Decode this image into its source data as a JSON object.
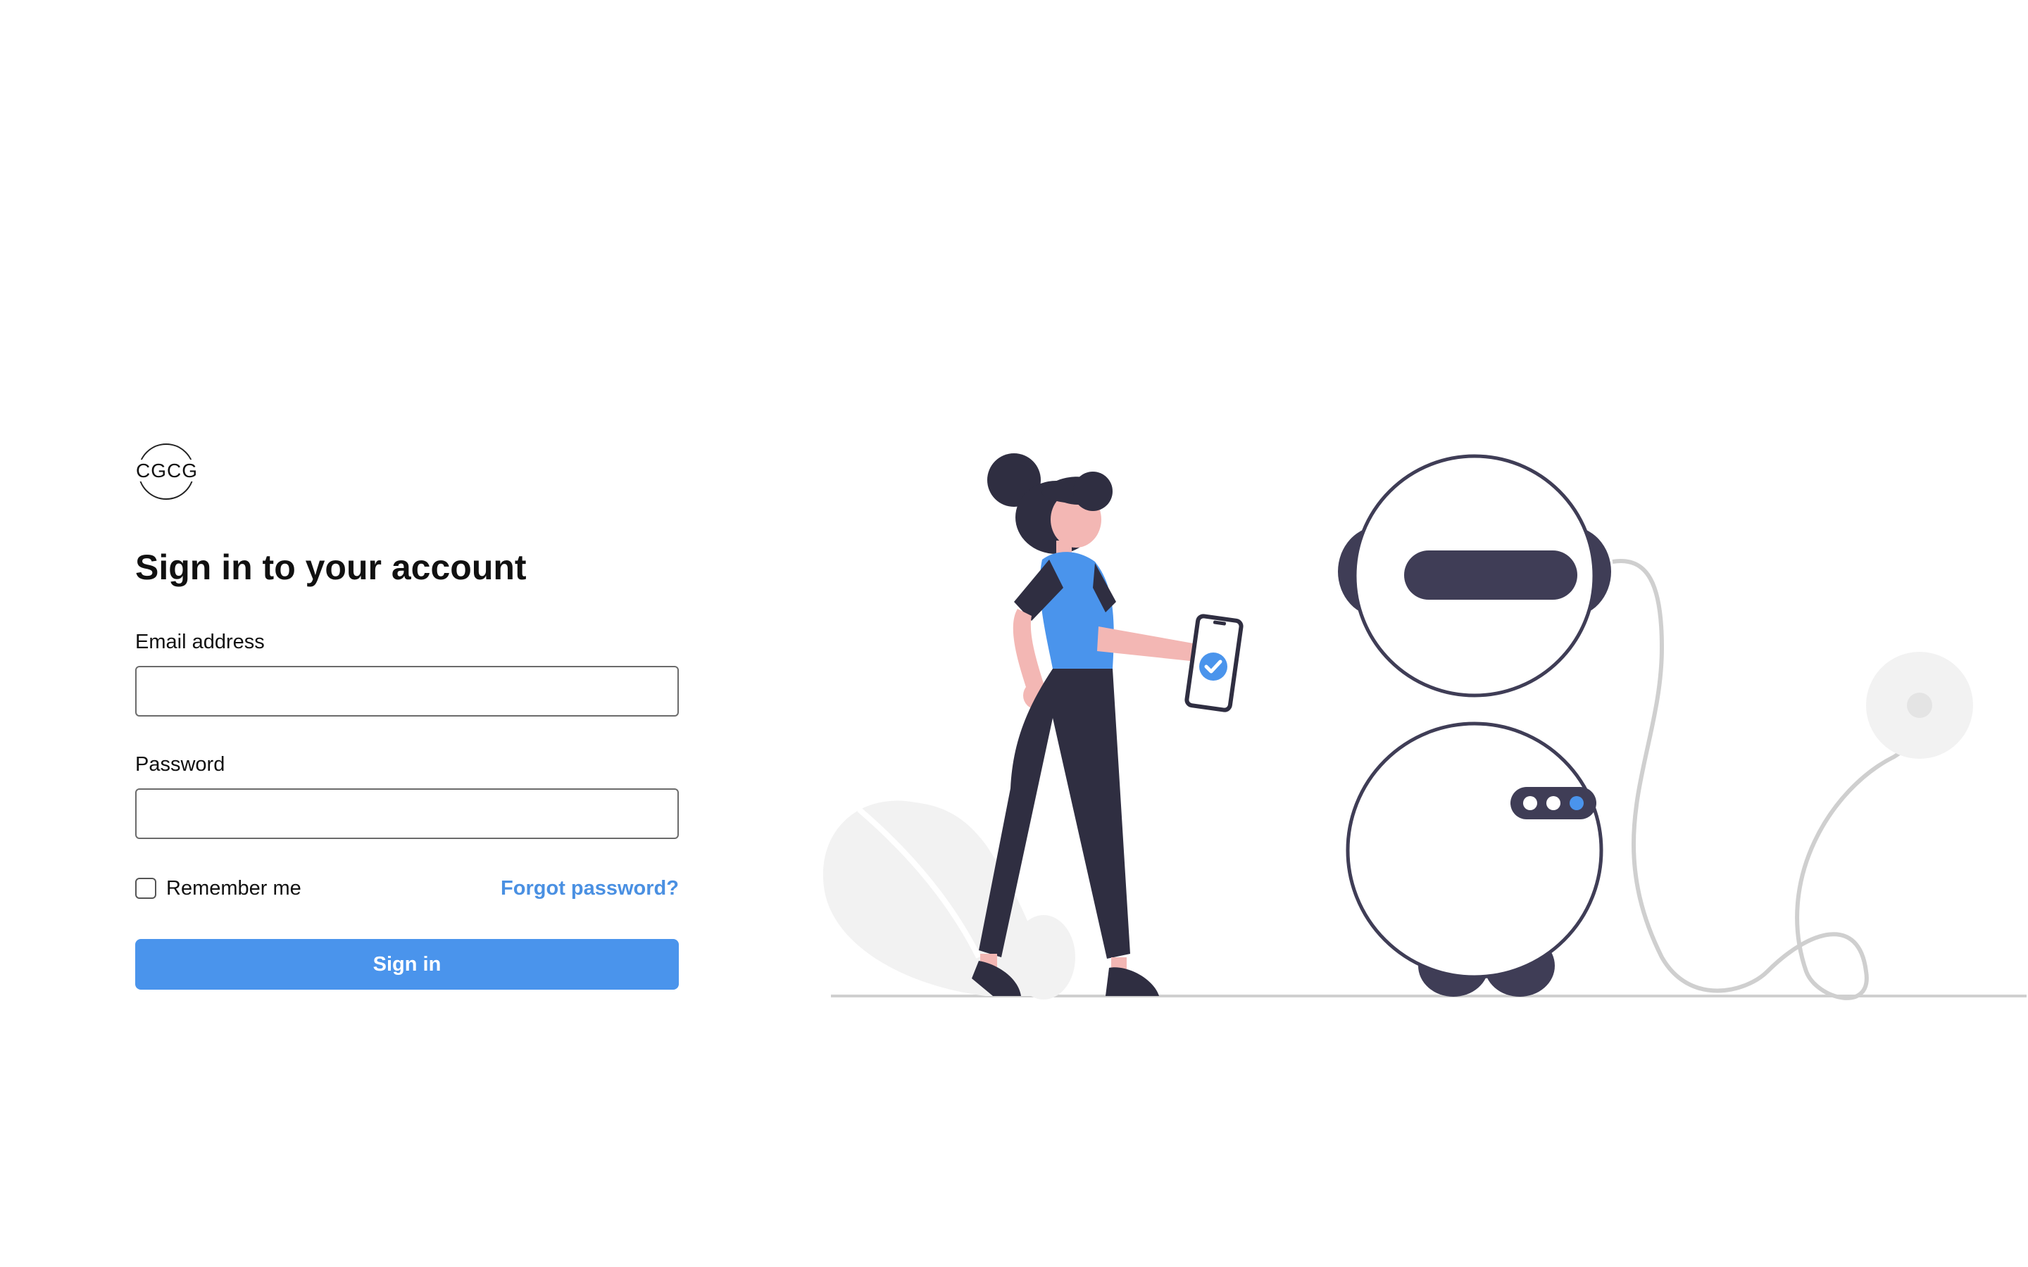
{
  "brand": {
    "logo_text": "CGCG"
  },
  "form": {
    "title": "Sign in to your account",
    "email_label": "Email address",
    "email_value": "",
    "password_label": "Password",
    "password_value": "",
    "remember_label": "Remember me",
    "remember_checked": false,
    "forgot_label": "Forgot password?",
    "submit_label": "Sign in"
  },
  "colors": {
    "accent": "#4a94ec",
    "link": "#4a90e2",
    "illustration_dark": "#2f2e41",
    "illustration_skin": "#f3b7b4",
    "illustration_gray": "#f2f2f2"
  },
  "illustration": {
    "icon": "person-with-phone-and-robot-illustration"
  }
}
